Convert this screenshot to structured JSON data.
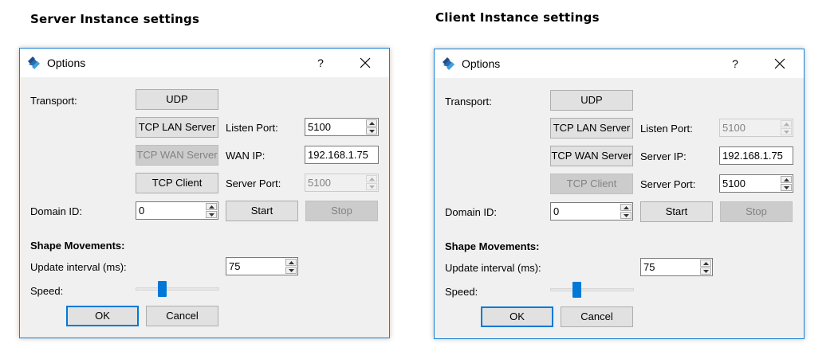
{
  "panels": [
    {
      "heading": "Server Instance settings",
      "window_title": "Options",
      "help_label": "?",
      "transport_label": "Transport:",
      "udp_label": "UDP",
      "tcp_lan_server_label": "TCP LAN Server",
      "tcp_wan_server_label": "TCP WAN Server",
      "tcp_client_label": "TCP Client",
      "row1_label": "Listen Port:",
      "row1_value": "5100",
      "row2_label": "WAN IP:",
      "row2_value": "192.168.1.75",
      "row3_label": "Server Port:",
      "row3_value": "5100",
      "domain_label": "Domain ID:",
      "domain_value": "0",
      "start_label": "Start",
      "stop_label": "Stop",
      "shape_heading": "Shape Movements:",
      "update_label": "Update interval (ms):",
      "update_value": "75",
      "speed_label": "Speed:",
      "speed_level": 0.3,
      "ok_label": "OK",
      "cancel_label": "Cancel"
    },
    {
      "heading": "Client Instance settings",
      "window_title": "Options",
      "help_label": "?",
      "transport_label": "Transport:",
      "udp_label": "UDP",
      "tcp_lan_server_label": "TCP LAN Server",
      "tcp_wan_server_label": "TCP WAN Server",
      "tcp_client_label": "TCP Client",
      "row1_label": "Listen Port:",
      "row1_value": "5100",
      "row2_label": "Server IP:",
      "row2_value": "192.168.1.75",
      "row3_label": "Server Port:",
      "row3_value": "5100",
      "domain_label": "Domain ID:",
      "domain_value": "0",
      "start_label": "Start",
      "stop_label": "Stop",
      "shape_heading": "Shape Movements:",
      "update_label": "Update interval (ms):",
      "update_value": "75",
      "speed_label": "Speed:",
      "speed_level": 0.3,
      "ok_label": "OK",
      "cancel_label": "Cancel"
    }
  ],
  "colors": {
    "accent": "#0078d7",
    "window_border": "#1883d7",
    "dialog_background": "#f0f0f0",
    "disabled_button": "#cccccc",
    "disabled_text": "#838383"
  },
  "icons": {
    "app": "app-logo-icon",
    "close": "close-icon",
    "spin_up": "spin-up-icon",
    "spin_down": "spin-down-icon"
  }
}
